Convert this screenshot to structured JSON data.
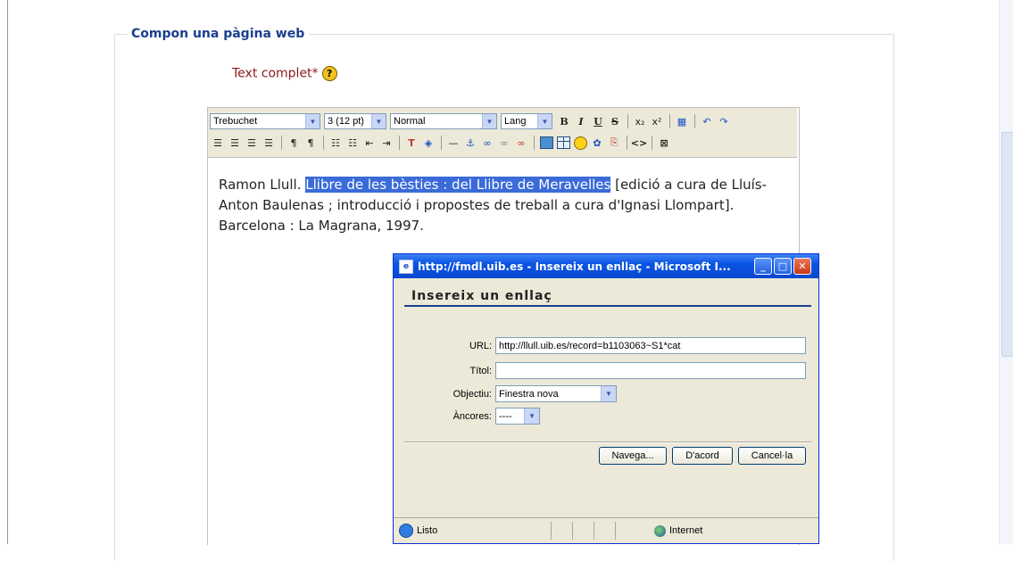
{
  "fieldset": {
    "legend": "Compon una pàgina web"
  },
  "field": {
    "label": "Text complet*",
    "help_icon": "?"
  },
  "toolbar": {
    "font": "Trebuchet",
    "size": "3 (12 pt)",
    "format": "Normal",
    "lang": "Lang",
    "bold": "B",
    "italic": "I",
    "underline": "U",
    "strike": "S"
  },
  "content": {
    "before": "Ramon Llull. ",
    "selected": "Llibre de les bèsties : del Llibre de Meravelles",
    "after": " [edició a cura de Lluís-Anton Baulenas ; introducció i propostes de treball a cura d'Ignasi Llompart]. Barcelona : La Magrana, 1997."
  },
  "dialog": {
    "window_title": "http://fmdl.uib.es - Insereix un enllaç - Microsoft I...",
    "heading": "Insereix un enllaç",
    "url_label": "URL:",
    "url_value": "http://llull.uib.es/record=b1103063~S1*cat",
    "title_label": "Títol:",
    "title_value": "",
    "target_label": "Objectiu:",
    "target_value": "Finestra nova",
    "anchors_label": "Àncores:",
    "anchors_value": "----",
    "browse_button": "Navega...",
    "ok_button": "D'acord",
    "cancel_button": "Cancel·la",
    "status_text": "Listo",
    "zone_text": "Internet"
  }
}
